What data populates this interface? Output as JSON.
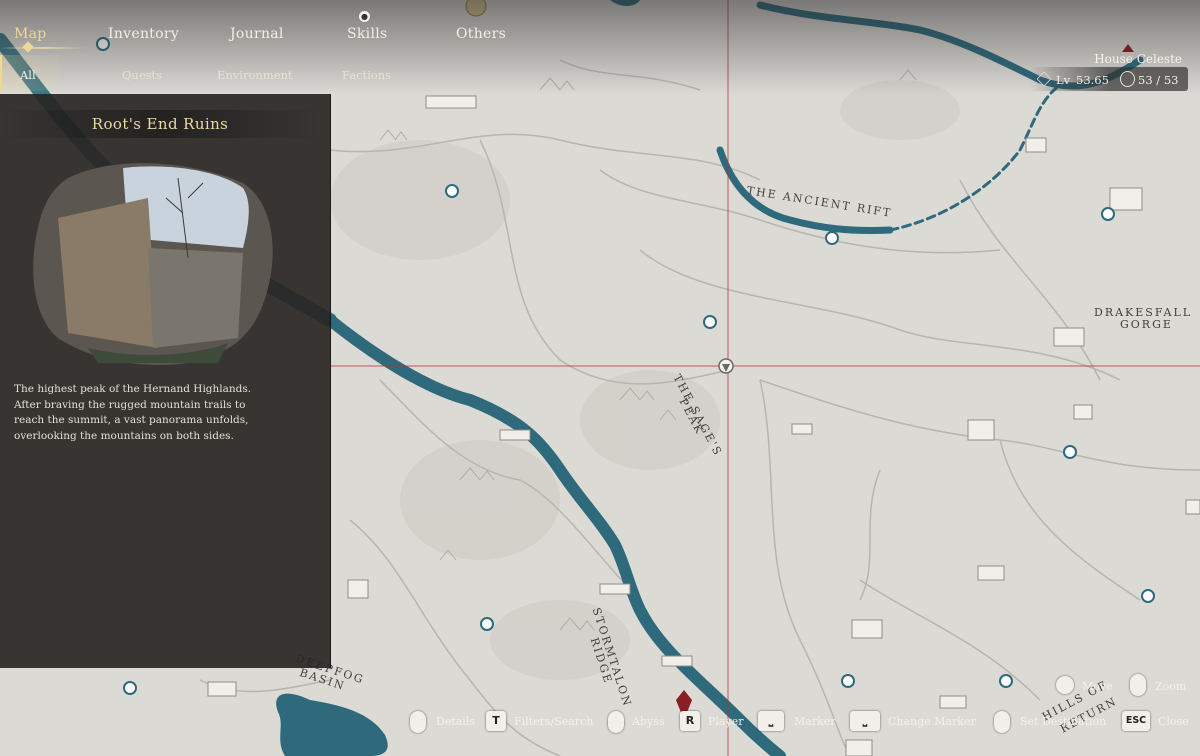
{
  "nav": {
    "tabs": [
      {
        "label": "Map"
      },
      {
        "label": "Inventory"
      },
      {
        "label": "Journal"
      },
      {
        "label": "Skills"
      },
      {
        "label": "Others"
      }
    ],
    "subtabs": [
      {
        "label": "All"
      },
      {
        "label": "Quests"
      },
      {
        "label": "Environment"
      },
      {
        "label": "Factions"
      }
    ]
  },
  "location": {
    "title": "Root's End Ruins",
    "description": "The highest peak of the Hernand Highlands. After braving the rugged mountain trails to reach the summit, a vast panorama unfolds, overlooking the mountains on both sides."
  },
  "player": {
    "house": "House Celeste",
    "level_label": "Lv",
    "level": "53.65",
    "count": "53 / 53"
  },
  "map_labels": {
    "ancient_rift": "THE ANCIENT RIFT",
    "drakesfall_1": "DRAKESFALL",
    "drakesfall_2": "GORGE",
    "sages_1": "THE SAGE'S",
    "sages_2": "PEAK",
    "stormtalon_1": "STORMTALON",
    "stormtalon_2": "RIDGE",
    "deepfog_1": "DEEPFOG",
    "deepfog_2": "BASIN",
    "hills_1": "HILLS OF",
    "hills_2": "RETURN"
  },
  "controls": {
    "move": "Move",
    "zoom": "Zoom",
    "details": "Details",
    "filters_key": "T",
    "filters": "Filters/Search",
    "abyss": "Abyss",
    "player_key": "R",
    "player": "Player",
    "marker_key": "⎵",
    "marker": "Marker",
    "change_marker_key": "⎵",
    "change_marker": "Change Marker",
    "set_destination": "Set Destination",
    "close_key": "ESC",
    "close": "Close"
  },
  "colors": {
    "river": "#2e6a7c",
    "map_bg": "#dcdad5",
    "panel_bg": "#2a2826",
    "accent": "#ecd89a",
    "crosshair": "#b3302f"
  }
}
